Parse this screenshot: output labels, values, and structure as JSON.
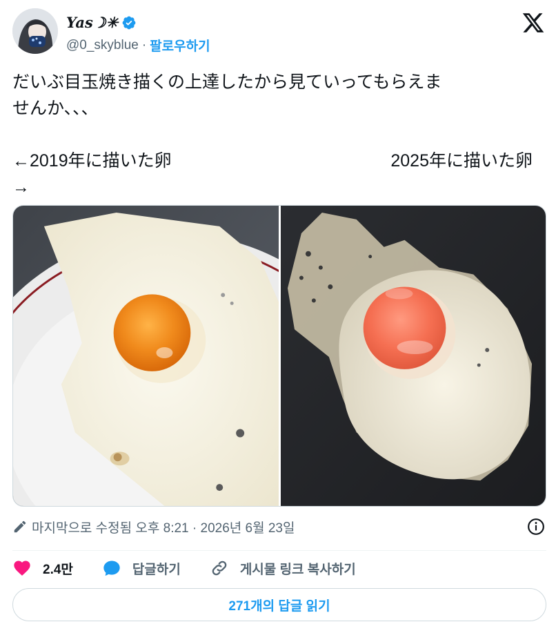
{
  "author": {
    "display_name": "Yas☽✳",
    "handle": "@0_skyblue",
    "separator": "·",
    "follow_label": "팔로우하기"
  },
  "tweet": {
    "line1": "だいぶ目玉焼き描くの上達したから見ていってもらえま",
    "line2": "せんか、、、",
    "left_label": "←2019年に描いた卵",
    "right_label": "2025年に描いた卵",
    "arrow_line": "→"
  },
  "meta": {
    "edited": "마지막으로 수정됨 오후 8:21 · 2026년 6월 23일"
  },
  "actions": {
    "likes": "2.4만",
    "reply_label": "답글하기",
    "copy_link_label": "게시물 링크 복사하기"
  },
  "read_replies_label": "271개의 답글 읽기",
  "colors": {
    "accent": "#1d9bf0",
    "like": "#f91880",
    "text": "#0f1419",
    "secondary": "#536471"
  },
  "icons": {
    "verified": "verified-badge-icon",
    "x_logo": "x-logo-icon",
    "pencil": "pencil-icon",
    "info": "info-icon",
    "heart": "heart-icon",
    "reply": "speech-bubble-icon",
    "link": "link-icon"
  }
}
